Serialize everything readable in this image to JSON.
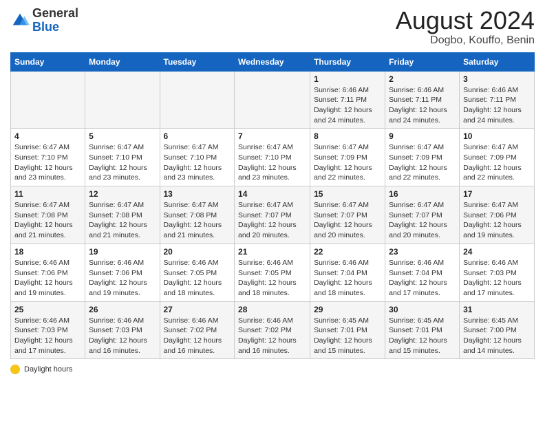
{
  "header": {
    "logo_line1": "General",
    "logo_line2": "Blue",
    "month_year": "August 2024",
    "location": "Dogbo, Kouffo, Benin"
  },
  "days_of_week": [
    "Sunday",
    "Monday",
    "Tuesday",
    "Wednesday",
    "Thursday",
    "Friday",
    "Saturday"
  ],
  "weeks": [
    [
      {
        "day": "",
        "detail": ""
      },
      {
        "day": "",
        "detail": ""
      },
      {
        "day": "",
        "detail": ""
      },
      {
        "day": "",
        "detail": ""
      },
      {
        "day": "1",
        "detail": "Sunrise: 6:46 AM\nSunset: 7:11 PM\nDaylight: 12 hours and 24 minutes."
      },
      {
        "day": "2",
        "detail": "Sunrise: 6:46 AM\nSunset: 7:11 PM\nDaylight: 12 hours and 24 minutes."
      },
      {
        "day": "3",
        "detail": "Sunrise: 6:46 AM\nSunset: 7:11 PM\nDaylight: 12 hours and 24 minutes."
      }
    ],
    [
      {
        "day": "4",
        "detail": "Sunrise: 6:47 AM\nSunset: 7:10 PM\nDaylight: 12 hours and 23 minutes."
      },
      {
        "day": "5",
        "detail": "Sunrise: 6:47 AM\nSunset: 7:10 PM\nDaylight: 12 hours and 23 minutes."
      },
      {
        "day": "6",
        "detail": "Sunrise: 6:47 AM\nSunset: 7:10 PM\nDaylight: 12 hours and 23 minutes."
      },
      {
        "day": "7",
        "detail": "Sunrise: 6:47 AM\nSunset: 7:10 PM\nDaylight: 12 hours and 23 minutes."
      },
      {
        "day": "8",
        "detail": "Sunrise: 6:47 AM\nSunset: 7:09 PM\nDaylight: 12 hours and 22 minutes."
      },
      {
        "day": "9",
        "detail": "Sunrise: 6:47 AM\nSunset: 7:09 PM\nDaylight: 12 hours and 22 minutes."
      },
      {
        "day": "10",
        "detail": "Sunrise: 6:47 AM\nSunset: 7:09 PM\nDaylight: 12 hours and 22 minutes."
      }
    ],
    [
      {
        "day": "11",
        "detail": "Sunrise: 6:47 AM\nSunset: 7:08 PM\nDaylight: 12 hours and 21 minutes."
      },
      {
        "day": "12",
        "detail": "Sunrise: 6:47 AM\nSunset: 7:08 PM\nDaylight: 12 hours and 21 minutes."
      },
      {
        "day": "13",
        "detail": "Sunrise: 6:47 AM\nSunset: 7:08 PM\nDaylight: 12 hours and 21 minutes."
      },
      {
        "day": "14",
        "detail": "Sunrise: 6:47 AM\nSunset: 7:07 PM\nDaylight: 12 hours and 20 minutes."
      },
      {
        "day": "15",
        "detail": "Sunrise: 6:47 AM\nSunset: 7:07 PM\nDaylight: 12 hours and 20 minutes."
      },
      {
        "day": "16",
        "detail": "Sunrise: 6:47 AM\nSunset: 7:07 PM\nDaylight: 12 hours and 20 minutes."
      },
      {
        "day": "17",
        "detail": "Sunrise: 6:47 AM\nSunset: 7:06 PM\nDaylight: 12 hours and 19 minutes."
      }
    ],
    [
      {
        "day": "18",
        "detail": "Sunrise: 6:46 AM\nSunset: 7:06 PM\nDaylight: 12 hours and 19 minutes."
      },
      {
        "day": "19",
        "detail": "Sunrise: 6:46 AM\nSunset: 7:06 PM\nDaylight: 12 hours and 19 minutes."
      },
      {
        "day": "20",
        "detail": "Sunrise: 6:46 AM\nSunset: 7:05 PM\nDaylight: 12 hours and 18 minutes."
      },
      {
        "day": "21",
        "detail": "Sunrise: 6:46 AM\nSunset: 7:05 PM\nDaylight: 12 hours and 18 minutes."
      },
      {
        "day": "22",
        "detail": "Sunrise: 6:46 AM\nSunset: 7:04 PM\nDaylight: 12 hours and 18 minutes."
      },
      {
        "day": "23",
        "detail": "Sunrise: 6:46 AM\nSunset: 7:04 PM\nDaylight: 12 hours and 17 minutes."
      },
      {
        "day": "24",
        "detail": "Sunrise: 6:46 AM\nSunset: 7:03 PM\nDaylight: 12 hours and 17 minutes."
      }
    ],
    [
      {
        "day": "25",
        "detail": "Sunrise: 6:46 AM\nSunset: 7:03 PM\nDaylight: 12 hours and 17 minutes."
      },
      {
        "day": "26",
        "detail": "Sunrise: 6:46 AM\nSunset: 7:03 PM\nDaylight: 12 hours and 16 minutes."
      },
      {
        "day": "27",
        "detail": "Sunrise: 6:46 AM\nSunset: 7:02 PM\nDaylight: 12 hours and 16 minutes."
      },
      {
        "day": "28",
        "detail": "Sunrise: 6:46 AM\nSunset: 7:02 PM\nDaylight: 12 hours and 16 minutes."
      },
      {
        "day": "29",
        "detail": "Sunrise: 6:45 AM\nSunset: 7:01 PM\nDaylight: 12 hours and 15 minutes."
      },
      {
        "day": "30",
        "detail": "Sunrise: 6:45 AM\nSunset: 7:01 PM\nDaylight: 12 hours and 15 minutes."
      },
      {
        "day": "31",
        "detail": "Sunrise: 6:45 AM\nSunset: 7:00 PM\nDaylight: 12 hours and 14 minutes."
      }
    ]
  ],
  "legend": {
    "daylight_label": "Daylight hours"
  },
  "colors": {
    "header_bg": "#1565c0",
    "header_text": "#ffffff",
    "odd_row_bg": "#f5f5f5",
    "even_row_bg": "#ffffff"
  }
}
